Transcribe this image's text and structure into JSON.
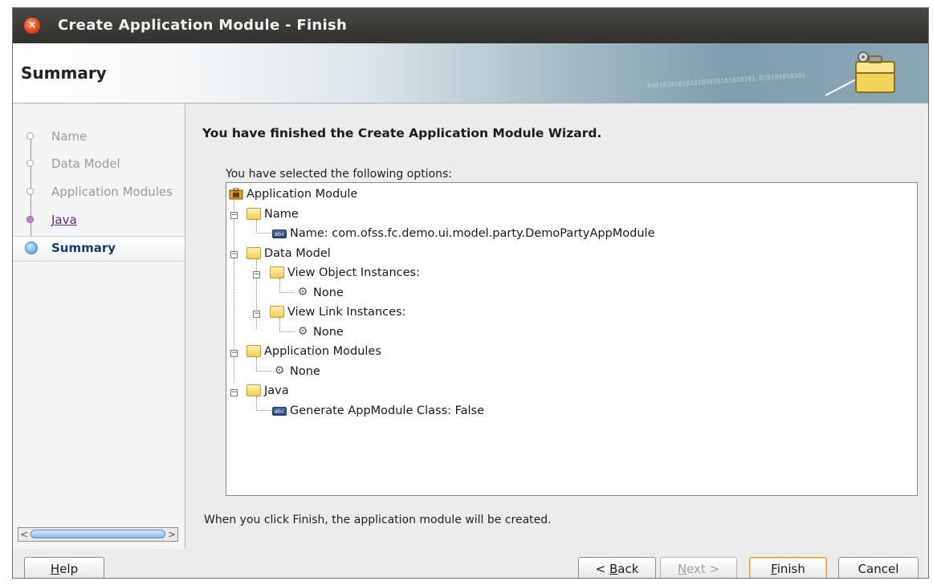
{
  "window": {
    "title": "Create Application Module - Finish",
    "close_icon": "close-icon"
  },
  "header": {
    "title": "Summary",
    "decor_binary": "0101010101010101010101010101 010101010101",
    "icon": "briefcase-gear-icon"
  },
  "steps": [
    {
      "label": "Name",
      "state": "visited"
    },
    {
      "label": "Data Model",
      "state": "visited"
    },
    {
      "label": "Application Modules",
      "state": "visited"
    },
    {
      "label": "Java",
      "state": "link"
    },
    {
      "label": "Summary",
      "state": "current"
    }
  ],
  "main": {
    "heading": "You have finished the Create Application Module Wizard.",
    "options_label": "You have selected the following options:",
    "footer_note": "When you click Finish, the application module will be created."
  },
  "tree": [
    {
      "text": "Application Module",
      "icon": "application-module-icon",
      "level": 0
    },
    {
      "text": "Name",
      "icon": "folder-icon",
      "level": 0
    },
    {
      "text": "Name: com.ofss.fc.demo.ui.model.party.DemoPartyAppModule",
      "icon": "field-icon",
      "level": 1
    },
    {
      "text": "Data Model",
      "icon": "folder-icon",
      "level": 0
    },
    {
      "text": "View Object Instances:",
      "icon": "folder-icon",
      "level": 1
    },
    {
      "text": "None",
      "icon": "gears-icon",
      "level": 2
    },
    {
      "text": "View Link Instances:",
      "icon": "folder-icon",
      "level": 1
    },
    {
      "text": "None",
      "icon": "gears-icon",
      "level": 2
    },
    {
      "text": "Application Modules",
      "icon": "folder-icon",
      "level": 0
    },
    {
      "text": "None",
      "icon": "gears-icon",
      "level": 1
    },
    {
      "text": "Java",
      "icon": "folder-icon",
      "level": 0
    },
    {
      "text": "Generate AppModule Class: False",
      "icon": "field-icon",
      "level": 1
    }
  ],
  "buttons": {
    "help": {
      "pre": "",
      "mn": "H",
      "post": "elp"
    },
    "back": {
      "pre": "< ",
      "mn": "B",
      "post": "ack"
    },
    "next": {
      "pre": "",
      "mn": "N",
      "post": "ext >"
    },
    "finish": {
      "pre": "",
      "mn": "F",
      "post": "inish"
    },
    "cancel": {
      "label": "Cancel"
    }
  }
}
